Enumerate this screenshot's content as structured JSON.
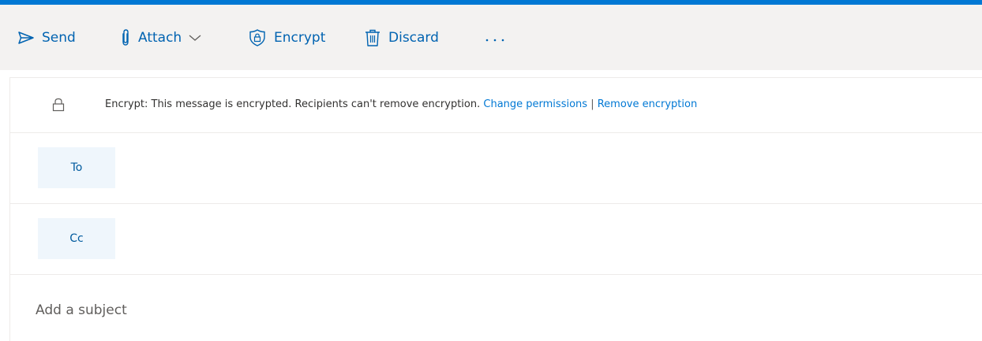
{
  "colors": {
    "accent": "#0078d4",
    "toolbar_bg": "#f3f2f1",
    "toolbar_text": "#0063b1",
    "recipient_button_bg": "#eff6fc"
  },
  "toolbar": {
    "send": {
      "label": "Send",
      "icon": "send-icon"
    },
    "attach": {
      "label": "Attach",
      "icon": "paperclip-icon",
      "dropdown_icon": "chevron-down-icon"
    },
    "encrypt": {
      "label": "Encrypt",
      "icon": "encrypt-shield-icon"
    },
    "discard": {
      "label": "Discard",
      "icon": "trash-icon"
    },
    "more": {
      "icon": "more-ellipsis-icon"
    }
  },
  "encryption_notice": {
    "icon": "lock-icon",
    "message": "Encrypt: This message is encrypted. Recipients can't remove encryption.",
    "change_permissions_link": "Change permissions",
    "separator": "|",
    "remove_encryption_link": "Remove encryption"
  },
  "recipients": {
    "to_label": "To",
    "cc_label": "Cc"
  },
  "subject": {
    "placeholder": "Add a subject",
    "value": ""
  }
}
